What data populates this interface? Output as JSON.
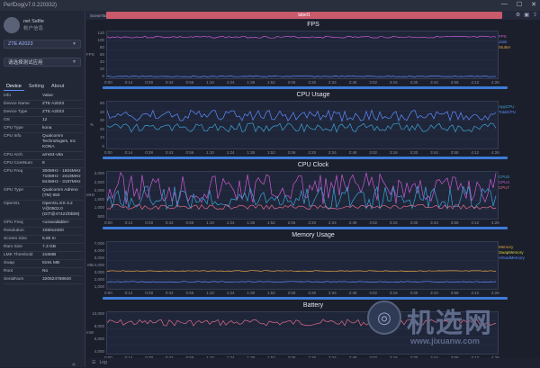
{
  "app": {
    "title": "PerfDog(v7.0.220332)",
    "window_controls": [
      "—",
      "☐",
      "✕"
    ]
  },
  "user": {
    "name": "net Selfie",
    "subtitle": "帐户信息"
  },
  "device_select": "ZTE A2023",
  "app_select": "请选择测试应用",
  "tabs": [
    "Device",
    "Setting",
    "About"
  ],
  "info": {
    "header": [
      "Info",
      "Value"
    ],
    "rows": [
      [
        "Device Name",
        "ZTE A2023"
      ],
      [
        "Device Type",
        "ZTE A2023"
      ],
      [
        "OS",
        "12"
      ],
      [
        "CPU Type",
        "kona"
      ],
      [
        "CPU Info",
        "Qualcomm Technologies, Inc KONA"
      ],
      [
        "CPU Arch",
        "arm64-v8a"
      ],
      [
        "CPU CoreNum",
        "8"
      ],
      [
        "CPU Freq",
        "300MHz - 1804MHz\n710MHz - 2419MHz\n844MHz - 3187MHz"
      ],
      [
        "GPU Type",
        "Qualcomm Adreno (TM) 650"
      ],
      [
        "OpenGL",
        "OpenGL ES 3.2 V@0502.0 (GIT@47421f0bb9)"
      ],
      [
        "GPU Freq",
        "<unavailable>"
      ],
      [
        "Resolution",
        "1080x2400"
      ],
      [
        "Screen Size",
        "6.80 In"
      ],
      [
        "Ram Size",
        "7.3 GB"
      ],
      [
        "LMK Threshold",
        "216MB"
      ],
      [
        "Swap",
        "8191 MB"
      ],
      [
        "Root",
        "No"
      ],
      [
        "SerialNum",
        "320524768640"
      ]
    ]
  },
  "toolbar": {
    "scene": "SceneTab",
    "label": "label1"
  },
  "x_ticks": [
    "0:00",
    "0:14",
    "0:28",
    "0:42",
    "0:56",
    "1:10",
    "1:24",
    "1:38",
    "1:52",
    "2:06",
    "2:20",
    "2:34",
    "2:48",
    "3:02",
    "3:16",
    "3:30",
    "3:44",
    "3:58",
    "4:12",
    "4:26"
  ],
  "charts": [
    {
      "title": "FPS",
      "ylabel": "FPS",
      "yticks": [
        "120",
        "100",
        "80",
        "60",
        "40",
        "20",
        "0"
      ],
      "legend": [
        {
          "text": "FPS",
          "color": "#c85ad1"
        },
        {
          "text": "Jank",
          "color": "#5c8dff"
        },
        {
          "text": "Stutter",
          "color": "#e0a040"
        }
      ]
    },
    {
      "title": "CPU Usage",
      "ylabel": "%",
      "yticks": [
        "50",
        "40",
        "30",
        "20",
        "10",
        "0"
      ],
      "legend": [
        {
          "text": "AppCPU",
          "color": "#3aa3d6"
        },
        {
          "text": "TotalCPU",
          "color": "#5c8dff"
        }
      ]
    },
    {
      "title": "CPU Clock",
      "ylabel": "MHz",
      "yticks": [
        "3,000",
        "2,500",
        "2,000",
        "1,500",
        "1,000",
        "500"
      ],
      "legend": [
        {
          "text": "CPU0",
          "color": "#3aa3d6"
        },
        {
          "text": "CPU4",
          "color": "#c85ad1"
        },
        {
          "text": "CPU7",
          "color": "#e06a8a"
        }
      ]
    },
    {
      "title": "Memory Usage",
      "ylabel": "MB",
      "yticks": [
        "7,000",
        "6,000",
        "5,000",
        "4,000",
        "3,000",
        "2,000",
        "1,000"
      ],
      "legend": [
        {
          "text": "Memory",
          "color": "#e0a040"
        },
        {
          "text": "SwapMemory",
          "color": "#d0d040"
        },
        {
          "text": "VirtualMemory",
          "color": "#5c8dff"
        }
      ]
    },
    {
      "title": "Battery",
      "ylabel": "mW",
      "yticks": [
        "10,000",
        "8,000",
        "6,000",
        "4,000"
      ],
      "legend": []
    }
  ],
  "status": {
    "log": "Log"
  },
  "watermark": {
    "text": "机选网",
    "url": "www.jixuanw.com"
  }
}
